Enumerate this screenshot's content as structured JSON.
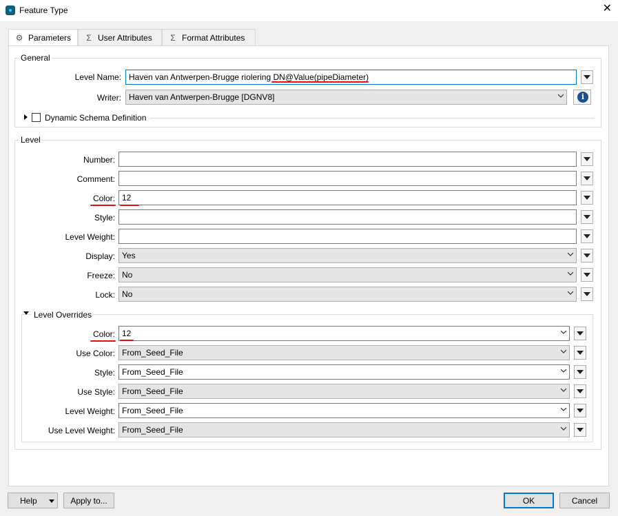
{
  "window": {
    "title": "Feature Type",
    "close_label": "✕"
  },
  "tabs": [
    {
      "label": "Parameters",
      "icon": "gear-icon"
    },
    {
      "label": "User Attributes",
      "icon": "sigma-icon"
    },
    {
      "label": "Format Attributes",
      "icon": "sigma-icon"
    }
  ],
  "general": {
    "title": "General",
    "level_name": {
      "label": "Level Name:",
      "value": "Haven van Antwerpen-Brugge riolering DN@Value(pipeDiameter)"
    },
    "writer": {
      "label": "Writer:",
      "value": "Haven van Antwerpen-Brugge [DGNV8]"
    },
    "dynamic_schema": {
      "label": "Dynamic Schema Definition",
      "checked": false
    }
  },
  "level": {
    "title": "Level",
    "rows": [
      {
        "label": "Number:",
        "value": ""
      },
      {
        "label": "Comment:",
        "value": ""
      },
      {
        "label": "Color:",
        "value": "12"
      },
      {
        "label": "Style:",
        "value": ""
      },
      {
        "label": "Level Weight:",
        "value": ""
      },
      {
        "label": "Display:",
        "value": "Yes"
      },
      {
        "label": "Freeze:",
        "value": "No"
      },
      {
        "label": "Lock:",
        "value": "No"
      }
    ]
  },
  "overrides": {
    "title": "Level Overrides",
    "rows": [
      {
        "label": "Color:",
        "value": "12"
      },
      {
        "label": "Use Color:",
        "value": "From_Seed_File"
      },
      {
        "label": "Style:",
        "value": "From_Seed_File"
      },
      {
        "label": "Use Style:",
        "value": "From_Seed_File"
      },
      {
        "label": "Level Weight:",
        "value": "From_Seed_File"
      },
      {
        "label": "Use Level Weight:",
        "value": "From_Seed_File"
      }
    ]
  },
  "footer": {
    "help": "Help",
    "apply_to": "Apply to...",
    "ok": "OK",
    "cancel": "Cancel"
  },
  "colors": {
    "accent": "#0078d7",
    "annotation": "#e01010"
  }
}
